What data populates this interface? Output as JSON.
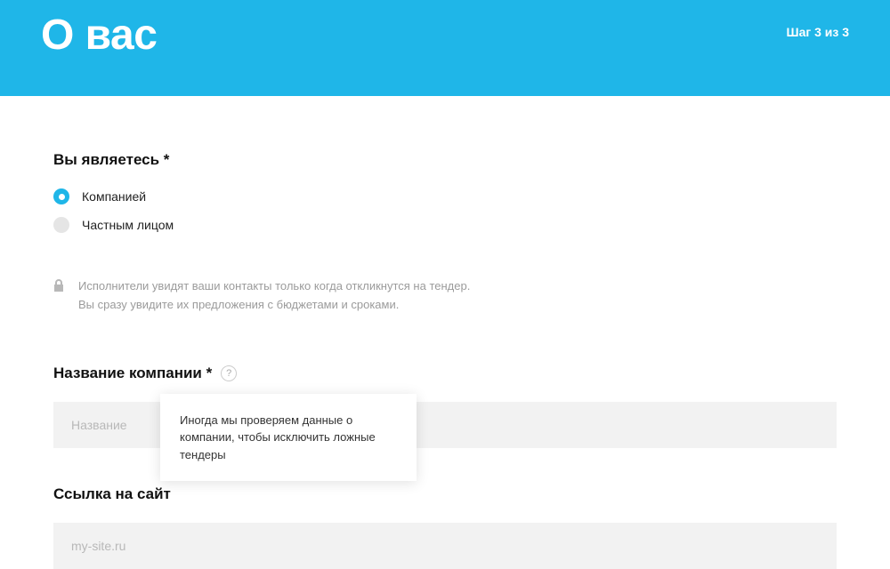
{
  "header": {
    "title": "О вас",
    "step": "Шаг 3 из 3"
  },
  "entity_type": {
    "label": "Вы являетесь *",
    "options": {
      "company": "Компанией",
      "individual": "Частным лицом"
    }
  },
  "privacy_note": {
    "line1": "Исполнители увидят ваши контакты только когда откликнутся на тендер.",
    "line2": "Вы сразу увидите их предложения с бюджетами и сроками."
  },
  "company_name": {
    "label": "Название компании *",
    "placeholder": "Название",
    "help_symbol": "?",
    "tooltip": "Иногда мы проверяем данные о компании, чтобы исключить ложные тендеры"
  },
  "website": {
    "label": "Ссылка на сайт",
    "placeholder": "my-site.ru"
  }
}
